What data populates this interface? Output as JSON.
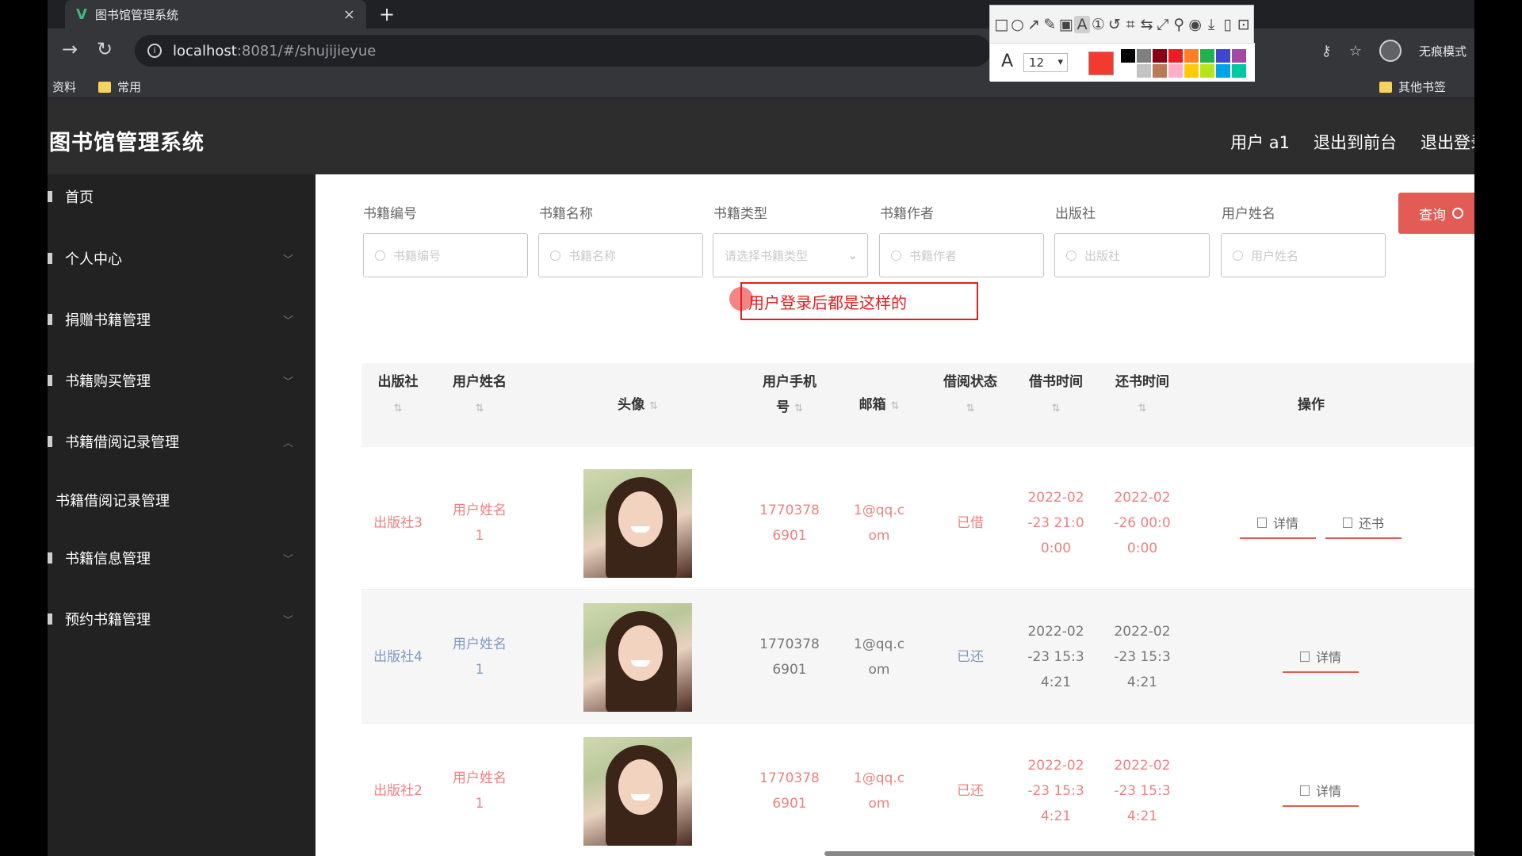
{
  "browser": {
    "tab_title": "图书馆管理系统",
    "tab_close": "×",
    "new_tab": "+",
    "url_host": "localhost",
    "url_path": ":8081/#/shujijieyue",
    "incognito_label": "无痕模式",
    "bookmarks": [
      "资料",
      "常用"
    ],
    "other_bookmarks": "其他书签"
  },
  "annotation_toolbar": {
    "font_size": "12",
    "current_color": "#f23a2f",
    "palette": [
      "#000000",
      "#7f7f7f",
      "#880015",
      "#ed1c24",
      "#ff7f27",
      "#22b14c",
      "#3f48cc",
      "#a349a4",
      "#ffffff",
      "#c3c3c3",
      "#b97a57",
      "#ffaec9",
      "#ffc90e",
      "#b5e61d",
      "#00a2e8",
      "#00c8a0"
    ]
  },
  "app": {
    "title": "图书馆管理系统",
    "header_links": [
      "用户 a1",
      "退出到前台",
      "退出登录"
    ]
  },
  "sidebar": {
    "items": [
      {
        "label": "首页"
      },
      {
        "label": "个人中心"
      },
      {
        "label": "捐赠书籍管理"
      },
      {
        "label": "书籍购买管理"
      },
      {
        "label": "书籍借阅记录管理"
      },
      {
        "label": "书籍借阅记录管理"
      },
      {
        "label": "书籍信息管理"
      },
      {
        "label": "预约书籍管理"
      }
    ]
  },
  "search": {
    "fields": [
      {
        "label": "书籍编号",
        "placeholder": "书籍编号"
      },
      {
        "label": "书籍名称",
        "placeholder": "书籍名称"
      },
      {
        "label": "书籍类型",
        "placeholder": "请选择书籍类型"
      },
      {
        "label": "书籍作者",
        "placeholder": "书籍作者"
      },
      {
        "label": "出版社",
        "placeholder": "出版社"
      },
      {
        "label": "用户姓名",
        "placeholder": "用户姓名"
      }
    ],
    "query_button": "查询"
  },
  "annotation_text": "用户登录后都是这样的",
  "table": {
    "headers": [
      "出版社",
      "用户姓名",
      "头像",
      "用户手机号",
      "邮箱",
      "借阅状态",
      "借书时间",
      "还书时间",
      "操作"
    ],
    "sort_glyph": "⇅",
    "header_lines": {
      "phone_1": "用户手机",
      "phone_2": "号"
    },
    "rows": [
      {
        "publisher": "出版社3",
        "user_1": "用户姓名",
        "user_2": "1",
        "phone_1": "1770378",
        "phone_2": "6901",
        "email_1": "1@qq.c",
        "email_2": "om",
        "status": "已借",
        "borrow_1": "2022-02",
        "borrow_2": "-23 21:0",
        "borrow_3": "0:00",
        "return_1": "2022-02",
        "return_2": "-26 00:0",
        "return_3": "0:00",
        "actions": [
          "详情",
          "还书"
        ]
      },
      {
        "publisher": "出版社4",
        "user_1": "用户姓名",
        "user_2": "1",
        "phone_1": "1770378",
        "phone_2": "6901",
        "email_1": "1@qq.c",
        "email_2": "om",
        "status": "已还",
        "borrow_1": "2022-02",
        "borrow_2": "-23 15:3",
        "borrow_3": "4:21",
        "return_1": "2022-02",
        "return_2": "-23 15:3",
        "return_3": "4:21",
        "actions": [
          "详情"
        ]
      },
      {
        "publisher": "出版社2",
        "user_1": "用户姓名",
        "user_2": "1",
        "phone_1": "1770378",
        "phone_2": "6901",
        "email_1": "1@qq.c",
        "email_2": "om",
        "status": "已还",
        "borrow_1": "2022-02",
        "borrow_2": "-23 15:3",
        "borrow_3": "4:21",
        "return_1": "2022-02",
        "return_2": "-23 15:3",
        "return_3": "4:21",
        "actions": [
          "详情"
        ]
      }
    ]
  },
  "colors": {
    "accent": "#e25b55",
    "row_pink": "#f08080",
    "row_blue": "#8099c2"
  }
}
